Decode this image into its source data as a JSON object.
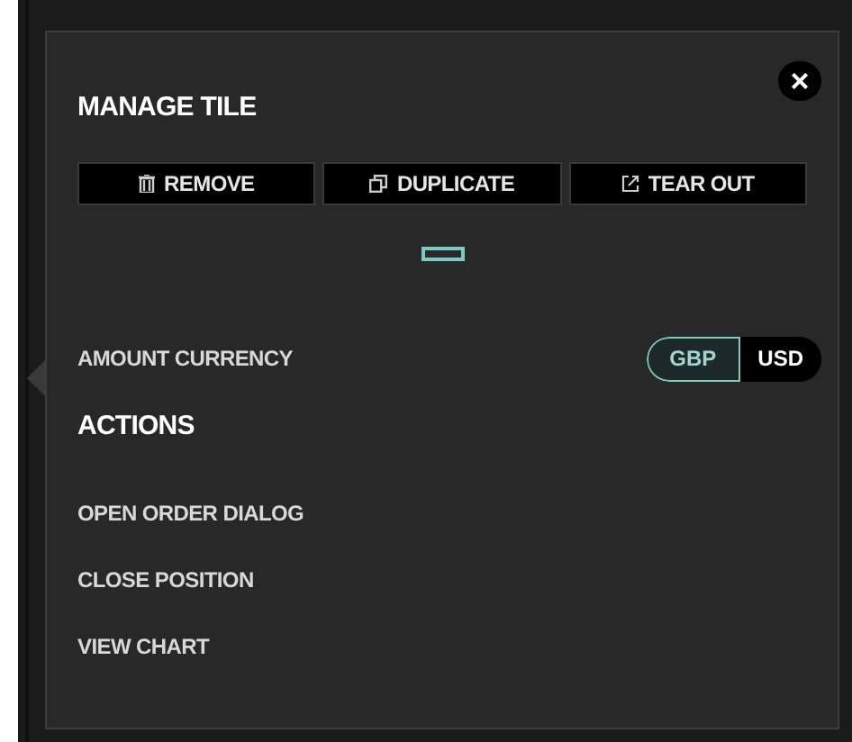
{
  "panel": {
    "title": "MANAGE TILE",
    "close_label": "×",
    "tile_buttons": [
      {
        "label": "REMOVE",
        "kind": "trash"
      },
      {
        "label": "DUPLICATE",
        "kind": "copy"
      },
      {
        "label": "TEAR OUT",
        "kind": "external"
      }
    ],
    "amount_currency": {
      "label": "AMOUNT CURRENCY",
      "options": [
        {
          "label": "GBP",
          "selected": true
        },
        {
          "label": "USD",
          "selected": false
        }
      ]
    },
    "actions": {
      "title": "ACTIONS",
      "items": [
        "OPEN ORDER DIALOG",
        "CLOSE POSITION",
        "VIEW CHART"
      ]
    }
  }
}
